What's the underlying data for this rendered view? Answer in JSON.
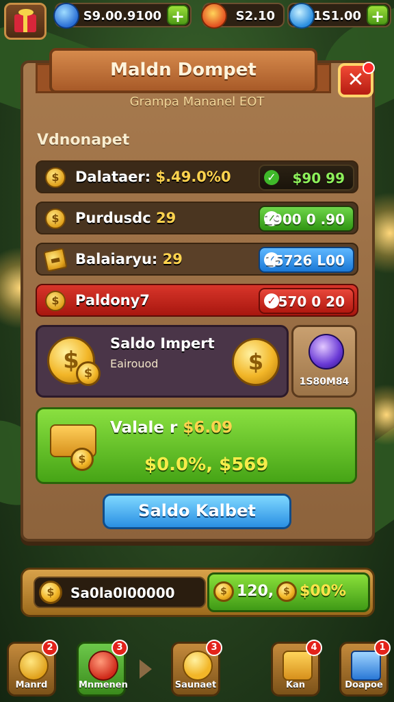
{
  "top_bar": {
    "resource_1_value": "S9.00.9100",
    "resource_2_value": "S2.10",
    "resource_3_value": "1S1.00",
    "plus_symbol": "+"
  },
  "panel": {
    "title": "Maldn Dompet",
    "subtitle": "Grampa Mananel EOT",
    "close_symbol": "✕",
    "section_label": "Vdnonapet",
    "rows": [
      {
        "label": "Dalataer:",
        "label_value": "$.49.0%0",
        "pill_value": "$90 99",
        "pill_color": "green",
        "check": "✓"
      },
      {
        "label": "Purdusdc",
        "label_value": "29",
        "pill_value": "1900 0 .90",
        "pill_color": "green",
        "check": "✓"
      },
      {
        "label": "Balaiaryu:",
        "label_value": "29",
        "pill_value": "15726 L00",
        "pill_color": "blue",
        "check": "✓"
      },
      {
        "label": "Paldony7",
        "label_value": "",
        "pill_value": "570 0  20",
        "pill_color": "red",
        "check": "✓"
      }
    ],
    "saldo_card": {
      "title": "Saldo Impert",
      "caption": "Eairouod",
      "coin_symbol": "$"
    },
    "gem_card": {
      "value": "1S80M84"
    },
    "value_card": {
      "label": "Valale r",
      "label_value": "$6.09",
      "values": "$0.0%, $569"
    },
    "cta_label": "Saldo Kalbet"
  },
  "bottom_bar": {
    "left_value": "Sa0la0l00000",
    "right_value_1": "120,",
    "right_value_2": "$00%"
  },
  "nav": [
    {
      "label": "Manrd",
      "badge": "2"
    },
    {
      "label": "Mnmenen",
      "badge": "3"
    },
    {
      "label": "Saunaet",
      "badge": "3"
    },
    {
      "label": "Kan",
      "badge": "4"
    },
    {
      "label": "Doapoe",
      "badge": "1"
    }
  ],
  "colors": {
    "green_pill": "#3fa918",
    "blue_pill": "#1f8be6",
    "red_row": "#c4201b",
    "gold_text": "#ffd34e"
  }
}
